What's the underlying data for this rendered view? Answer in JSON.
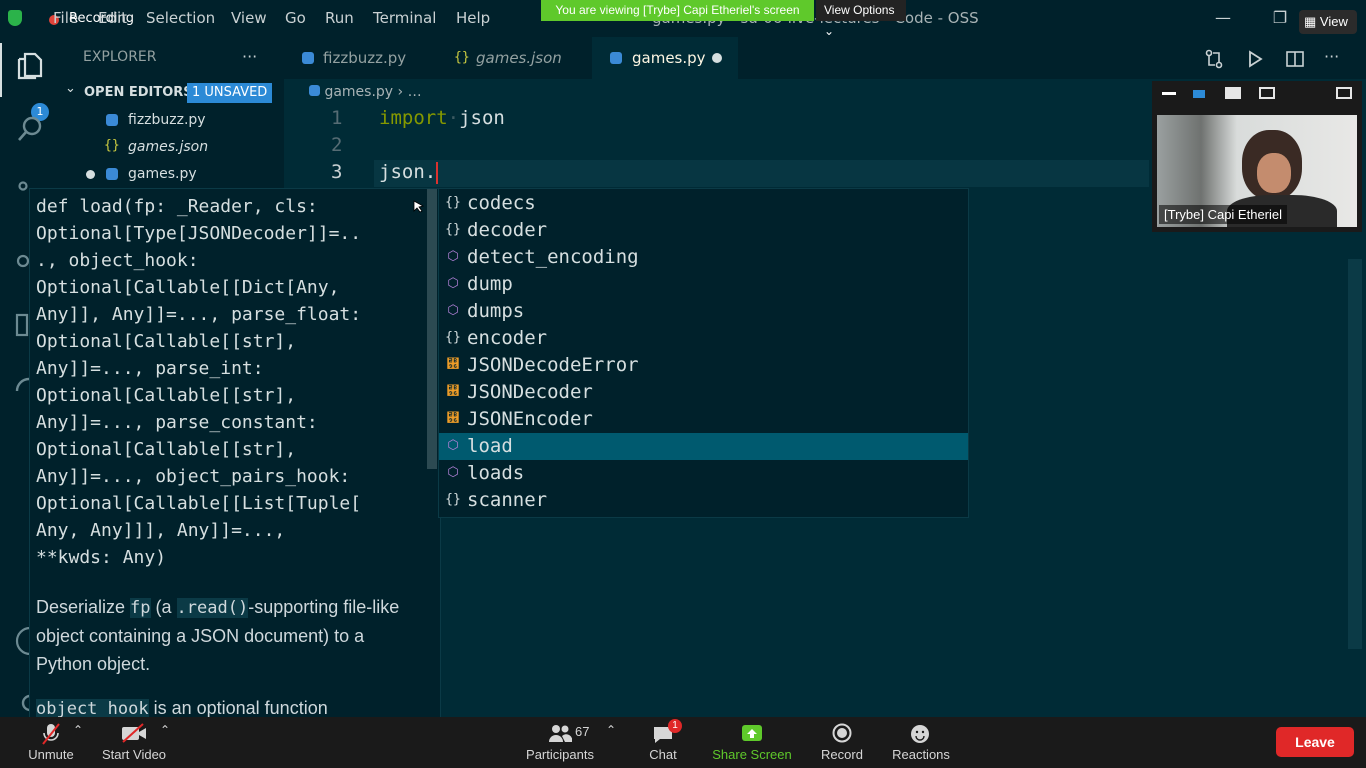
{
  "titlebar": {
    "recording": "Recording",
    "menu": [
      "File",
      "Edit",
      "Selection",
      "View",
      "Go",
      "Run",
      "Terminal",
      "Help"
    ],
    "window_title": "games.py - sd-06-live-lectures - Code - OSS",
    "viewing_banner": "You are viewing [Trybe] Capi Etheriel's screen",
    "view_options": "View Options",
    "view_button": "View"
  },
  "activitybar": {
    "badge": "1"
  },
  "sidebar": {
    "title": "EXPLORER",
    "more": "···",
    "open_editors": "OPEN EDITORS",
    "unsaved_badge": "1 UNSAVED",
    "files": [
      {
        "name": "fizzbuzz.py",
        "type": "py"
      },
      {
        "name": "games.json",
        "type": "json"
      },
      {
        "name": "games.py",
        "type": "py",
        "dirty": true
      }
    ]
  },
  "tabs": [
    {
      "label": "fizzbuzz.py",
      "icon": "python-icon"
    },
    {
      "label": "games.json",
      "icon": "json-icon"
    },
    {
      "label": "games.py",
      "icon": "python-icon",
      "active": true
    }
  ],
  "breadcrumb": {
    "file": "games.py",
    "rest": "…"
  },
  "code": {
    "lines": [
      {
        "num": "1",
        "keyword": "import",
        "space": "·",
        "text": "json"
      },
      {
        "num": "2",
        "keyword": "",
        "space": "",
        "text": ""
      },
      {
        "num": "3",
        "keyword": "",
        "space": "",
        "text": "json."
      }
    ]
  },
  "hover": {
    "signature": "def load(fp: _Reader, cls:\nOptional[Type[JSONDecoder]]=..\n., object_hook:\nOptional[Callable[[Dict[Any,\nAny]], Any]]=..., parse_float:\nOptional[Callable[[str],\nAny]]=..., parse_int:\nOptional[Callable[[str],\nAny]]=..., parse_constant:\nOptional[Callable[[str],\nAny]]=..., object_pairs_hook:\nOptional[Callable[[List[Tuple[\nAny, Any]]], Any]]=...,\n**kwds: Any)",
    "doc_prefix": "Deserialize ",
    "doc_code1": "fp",
    "doc_mid": " (a ",
    "doc_code2": ".read()",
    "doc_suffix": "-supporting file-like object containing a JSON document) to a Python object.",
    "doc2_code": "object_hook",
    "doc2_text": " is an optional function"
  },
  "suggestions": [
    {
      "label": "codecs",
      "kind": "module"
    },
    {
      "label": "decoder",
      "kind": "module"
    },
    {
      "label": "detect_encoding",
      "kind": "function"
    },
    {
      "label": "dump",
      "kind": "function"
    },
    {
      "label": "dumps",
      "kind": "function"
    },
    {
      "label": "encoder",
      "kind": "module"
    },
    {
      "label": "JSONDecodeError",
      "kind": "class"
    },
    {
      "label": "JSONDecoder",
      "kind": "class"
    },
    {
      "label": "JSONEncoder",
      "kind": "class"
    },
    {
      "label": "load",
      "kind": "function",
      "selected": true
    },
    {
      "label": "loads",
      "kind": "function"
    },
    {
      "label": "scanner",
      "kind": "module"
    }
  ],
  "video": {
    "name": "[Trybe] Capi Etheriel"
  },
  "zoom": {
    "unmute": "Unmute",
    "start_video": "Start Video",
    "participants_count": "67",
    "participants": "Participants",
    "chat": "Chat",
    "chat_badge": "1",
    "share_screen": "Share Screen",
    "record": "Record",
    "reactions": "Reactions",
    "leave": "Leave"
  },
  "colors": {
    "accent_green": "#5fc92b",
    "leave_red": "#e02828",
    "selection": "#005a6f",
    "badge_blue": "#2aa198"
  }
}
